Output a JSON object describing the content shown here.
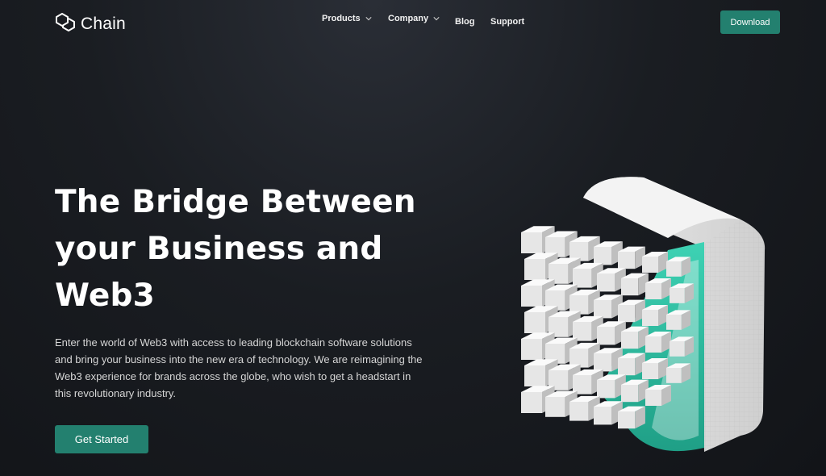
{
  "brand": {
    "name": "Chain",
    "icon": "hexagon-chain-logo-icon"
  },
  "nav": {
    "items": [
      {
        "label": "Products",
        "has_dropdown": true
      },
      {
        "label": "Company",
        "has_dropdown": true
      },
      {
        "label": "Blog",
        "has_dropdown": false
      },
      {
        "label": "Support",
        "has_dropdown": false
      }
    ],
    "download_label": "Download"
  },
  "hero": {
    "title": "The Bridge Between your Business and Web3",
    "description": "Enter the world of Web3 with access to leading blockchain software solutions and bring your business into the new era of technology. We are reimagining the Web3 experience for brands across the globe, who wish to get a headstart in this revolutionary industry.",
    "cta_label": "Get Started",
    "illustration": "3d-cube-blocks-illustration"
  },
  "colors": {
    "accent": "#23806f",
    "teal": "#2ec4a6",
    "background": "#16191d"
  }
}
